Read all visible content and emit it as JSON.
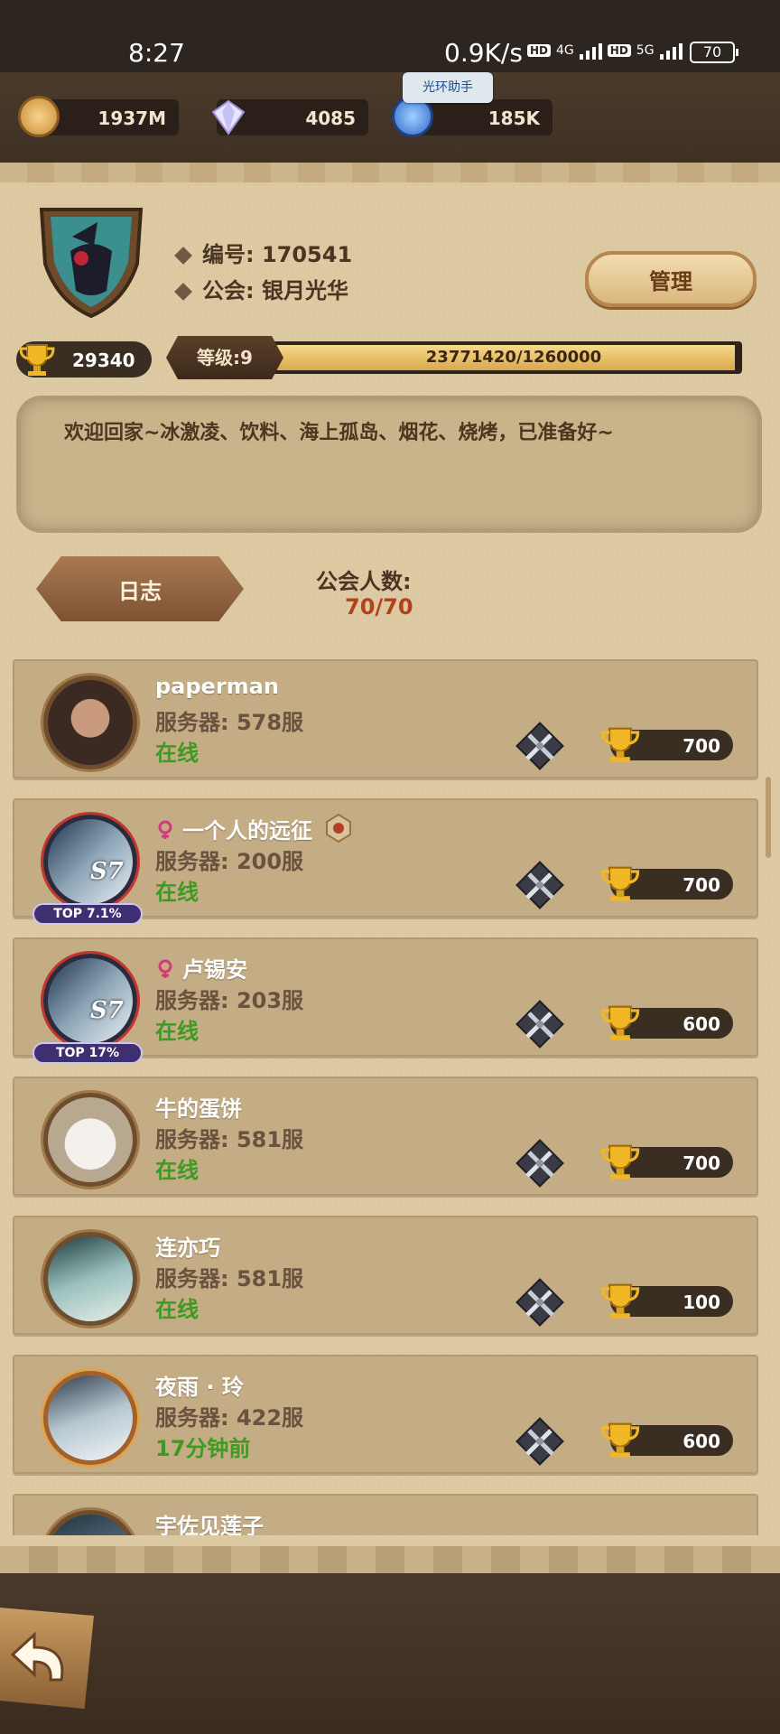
{
  "status_bar": {
    "time": "8:27",
    "speed": "0.9K/s",
    "network1": "4G",
    "network2": "5G",
    "hd": "HD",
    "battery": "70"
  },
  "resources": {
    "gold": "1937M",
    "diamonds": "4085",
    "dust": "185K",
    "helper_tag": "光环助手"
  },
  "guild": {
    "id_label": "编号: 170541",
    "name_label": "公会: 银月光华",
    "manage_button": "管理",
    "trophies": "29340",
    "level_label": "等级:9",
    "xp_text": "23771420/1260000",
    "xp_fill_fraction": 1.0,
    "notice": "欢迎回家~冰激凌、饮料、海上孤岛、烟花、烧烤，已准备好~",
    "log_button": "日志",
    "member_label": "公会人数:",
    "member_count": "70/70"
  },
  "members": [
    {
      "name": "paperman",
      "server": "服务器: 578服",
      "status": "在线",
      "score": "700",
      "avatar": "a1",
      "gender": "",
      "top": "",
      "s7": false,
      "badge": false
    },
    {
      "name": "一个人的远征",
      "server": "服务器: 200服",
      "status": "在线",
      "score": "700",
      "avatar": "a2",
      "gender": "female",
      "top": "TOP 7.1%",
      "s7": true,
      "badge": true
    },
    {
      "name": "卢锡安",
      "server": "服务器: 203服",
      "status": "在线",
      "score": "600",
      "avatar": "a3",
      "gender": "female",
      "top": "TOP 17%",
      "s7": true,
      "badge": false
    },
    {
      "name": "牛的蛋饼",
      "server": "服务器: 581服",
      "status": "在线",
      "score": "700",
      "avatar": "a4",
      "gender": "",
      "top": "",
      "s7": false,
      "badge": false
    },
    {
      "name": "连亦巧",
      "server": "服务器: 581服",
      "status": "在线",
      "score": "100",
      "avatar": "a5",
      "gender": "",
      "top": "",
      "s7": false,
      "badge": false
    },
    {
      "name": "夜雨 · 玲",
      "server": "服务器: 422服",
      "status": "17分钟前",
      "score": "600",
      "avatar": "a6",
      "gender": "",
      "top": "",
      "s7": false,
      "badge": false
    },
    {
      "name": "宇佐见莲子",
      "server": "",
      "status": "",
      "score": "",
      "avatar": "a7",
      "gender": "",
      "top": "",
      "s7": false,
      "badge": false
    }
  ],
  "colors": {
    "online": "#3e9a22",
    "panel": "#dcc9a2",
    "member_count": "#b1421b"
  },
  "icons": {
    "back": "back-arrow-icon",
    "battle": "crossed-swords-icon",
    "trophy": "trophy-icon"
  }
}
